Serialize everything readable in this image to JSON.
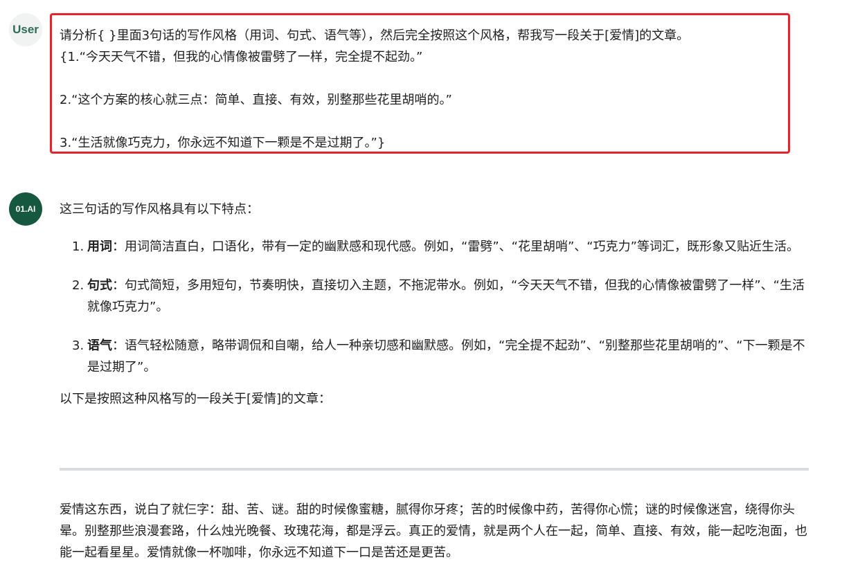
{
  "user": {
    "avatar_label": "User",
    "lines": [
      "请分析{ }里面3句话的写作风格（用词、句式、语气等），然后完全按照这个风格，帮我写一段关于[爱情]的文章。",
      "{1.“今天天气不错，但我的心情像被雷劈了一样，完全提不起劲。”",
      "2.“这个方案的核心就三点：简单、直接、有效，别整那些花里胡哨的。”",
      "3.“生活就像巧克力，你永远不知道下一颗是不是过期了。”}"
    ]
  },
  "assistant": {
    "avatar_label": "01.AI",
    "intro": "这三句话的写作风格具有以下特点：",
    "points": [
      {
        "num": "1.",
        "term": "用词",
        "text": "：用词简洁直白，口语化，带有一定的幽默感和现代感。例如，“雷劈”、“花里胡哨”、“巧克力”等词汇，既形象又贴近生活。"
      },
      {
        "num": "2.",
        "term": "句式",
        "text": "：句式简短，多用短句，节奏明快，直接切入主题，不拖泥带水。例如，“今天天气不错，但我的心情像被雷劈了一样”、“生活就像巧克力”。"
      },
      {
        "num": "3.",
        "term": "语气",
        "text": "：语气轻松随意，略带调侃和自嘲，给人一种亲切感和幽默感。例如，“完全提不起劲”、“别整那些花里胡哨的”、“下一颗是不是过期了”。"
      }
    ],
    "lead": "以下是按照这种风格写的一段关于[爱情]的文章：",
    "essay": "爱情这东西，说白了就仨字：甜、苦、谜。甜的时候像蜜糖，腻得你牙疼；苦的时候像中药，苦得你心慌；谜的时候像迷宫，绕得你头晕。别整那些浪漫套路，什么烛光晚餐、玫瑰花海，都是浮云。真正的爱情，就是两个人在一起，简单、直接、有效，能一起吃泡面，也能一起看星星。爱情就像一杯咖啡，你永远不知道下一口是苦还是更苦。"
  },
  "colors": {
    "highlight_border": "#e8222a",
    "ai_avatar_bg": "#16573f",
    "user_avatar_text": "#2d6b55",
    "divider": "#d9dcde"
  }
}
